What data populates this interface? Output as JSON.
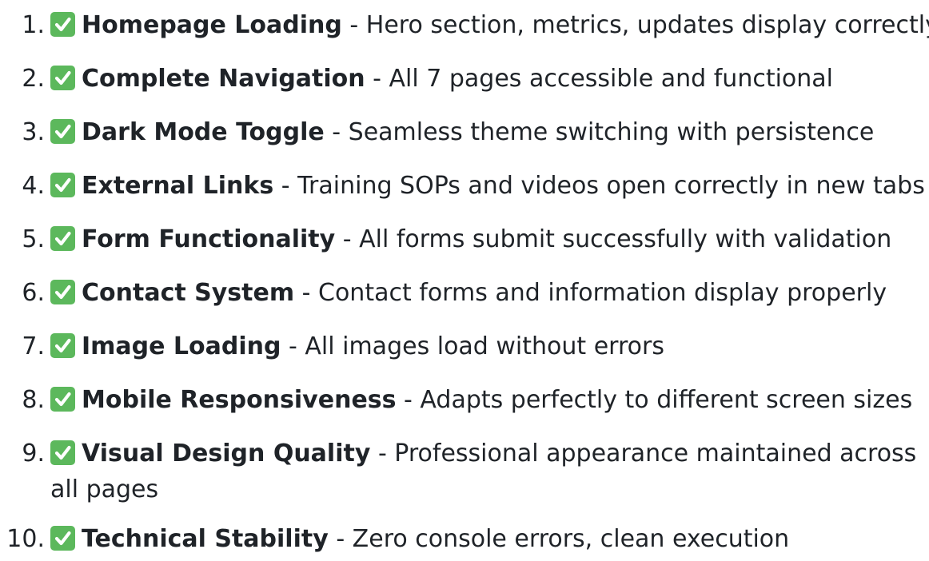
{
  "items": [
    {
      "num": "1.",
      "title": "Homepage Loading",
      "desc": " - Hero section, metrics, updates display correctly"
    },
    {
      "num": "2.",
      "title": "Complete Navigation",
      "desc": " - All 7 pages accessible and functional"
    },
    {
      "num": "3.",
      "title": "Dark Mode Toggle",
      "desc": " - Seamless theme switching with persistence"
    },
    {
      "num": "4.",
      "title": "External Links",
      "desc": " - Training SOPs and videos open correctly in new tabs"
    },
    {
      "num": "5.",
      "title": "Form Functionality",
      "desc": " - All forms submit successfully with validation"
    },
    {
      "num": "6.",
      "title": "Contact System",
      "desc": " - Contact forms and information display properly"
    },
    {
      "num": "7.",
      "title": "Image Loading",
      "desc": " - All images load without errors"
    },
    {
      "num": "8.",
      "title": "Mobile Responsiveness",
      "desc": " - Adapts perfectly to different screen sizes"
    },
    {
      "num": "9.",
      "title": "Visual Design Quality",
      "desc": " - Professional appearance maintained across all pages"
    },
    {
      "num": "10.",
      "title": "Technical Stability",
      "desc": " - Zero console errors, clean execution"
    }
  ],
  "icon": "check-mark-button-icon",
  "colors": {
    "check_bg": "#5cb85c",
    "check_mark": "#ffffff",
    "text": "#1f2328"
  }
}
